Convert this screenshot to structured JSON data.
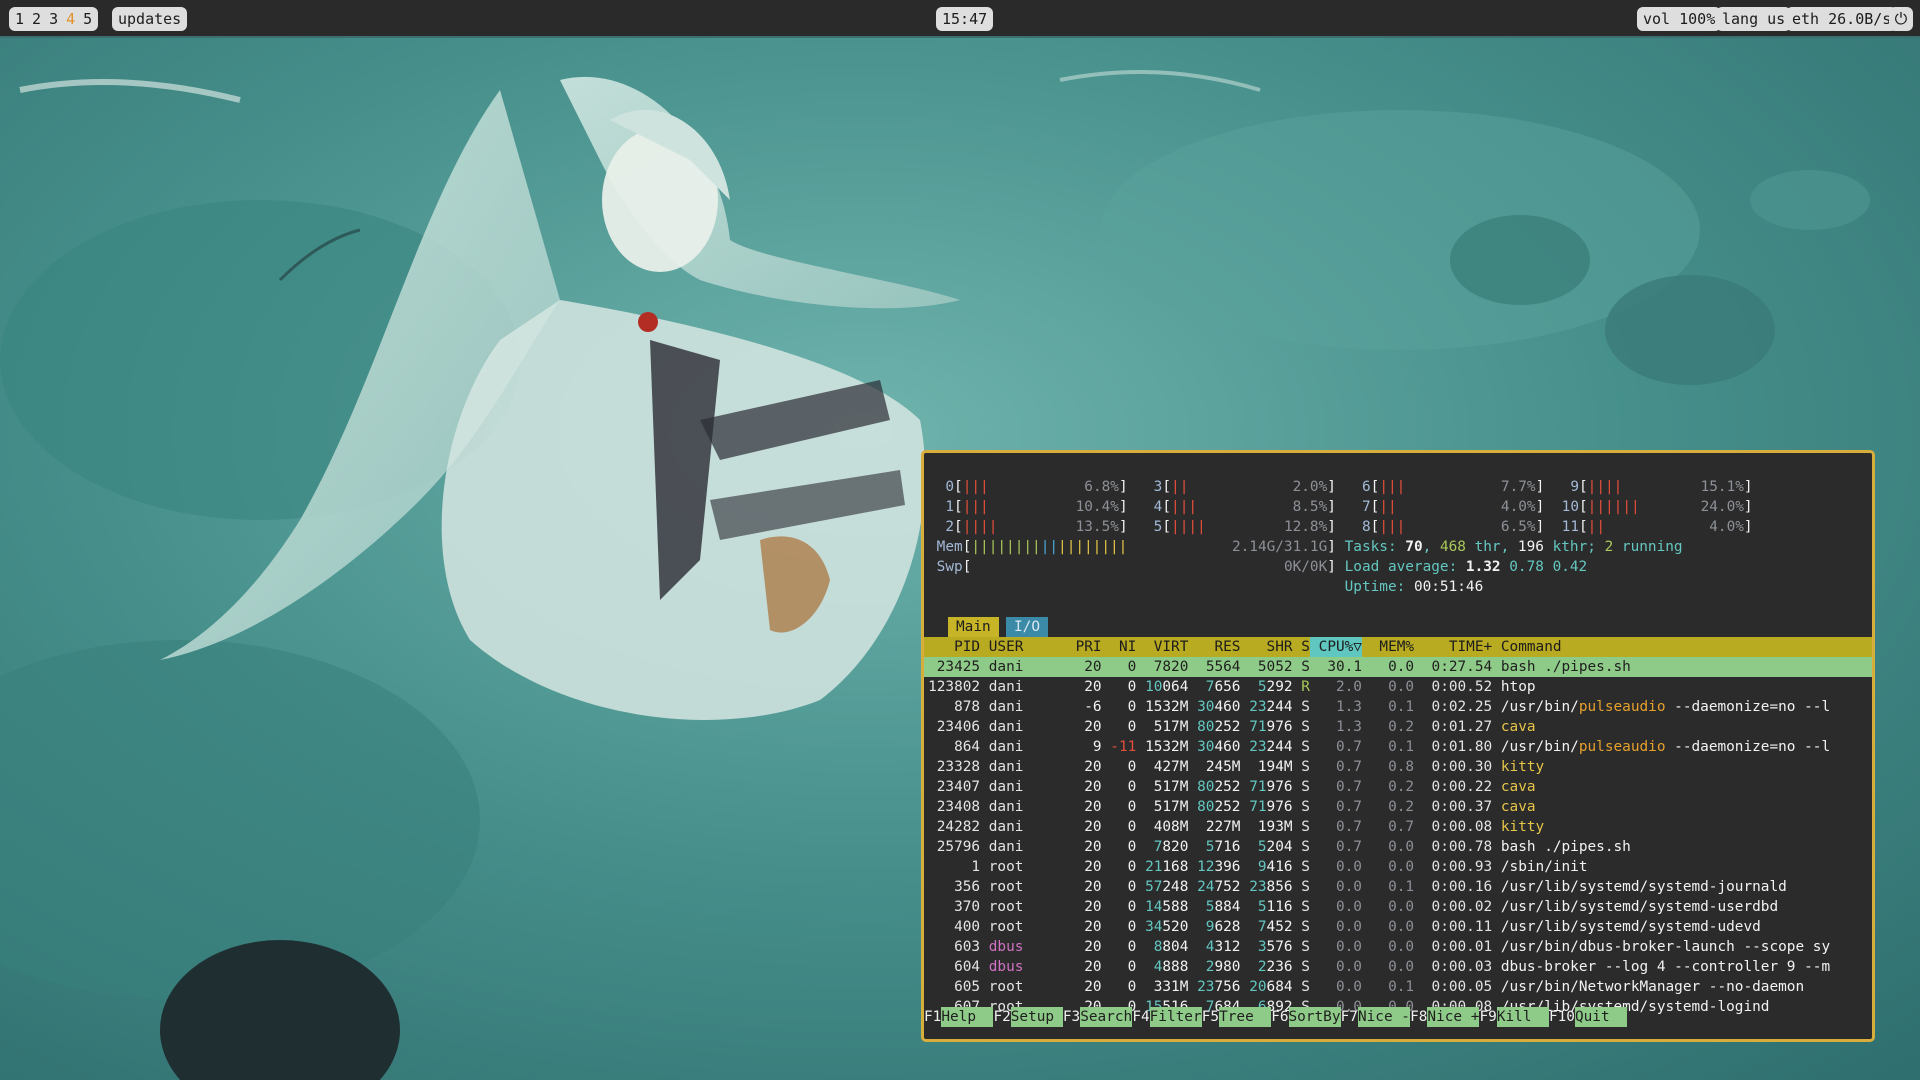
{
  "topbar": {
    "workspaces": [
      "1",
      "2",
      "3",
      "4",
      "5"
    ],
    "active_workspace": "4",
    "updates_label": "updates",
    "clock": "15:47",
    "volume": "vol 100%",
    "lang": "lang us",
    "network": "eth 26.0B/s",
    "power_icon": "power-icon"
  },
  "htop": {
    "cpus": [
      {
        "id": "0",
        "bars": "|||",
        "pct": "6.8%"
      },
      {
        "id": "1",
        "bars": "|||",
        "pct": "10.4%"
      },
      {
        "id": "2",
        "bars": "||||",
        "pct": "13.5%"
      },
      {
        "id": "3",
        "bars": "||",
        "pct": "2.0%"
      },
      {
        "id": "4",
        "bars": "|||",
        "pct": "8.5%"
      },
      {
        "id": "5",
        "bars": "||||",
        "pct": "12.8%"
      },
      {
        "id": "6",
        "bars": "|||",
        "pct": "7.7%"
      },
      {
        "id": "7",
        "bars": "||",
        "pct": "4.0%"
      },
      {
        "id": "8",
        "bars": "|||",
        "pct": "6.5%"
      },
      {
        "id": "9",
        "bars": "||||",
        "pct": "15.1%"
      },
      {
        "id": "10",
        "bars": "||||||",
        "pct": "24.0%"
      },
      {
        "id": "11",
        "bars": "||",
        "pct": "4.0%"
      }
    ],
    "mem_label": "Mem",
    "mem_bars": "||||||||||||||||||",
    "mem_value": "2.14G/31.1G",
    "swp_label": "Swp",
    "swp_value": "0K/0K",
    "tasks": {
      "label": "Tasks: ",
      "tasks": "70",
      "thr": "468",
      "thr_label": " thr, ",
      "kthr": "196",
      "kthr_label": " kthr; ",
      "running": "2",
      "running_label": " running"
    },
    "load": {
      "label": "Load average: ",
      "one": "1.32",
      "five": "0.78",
      "fifteen": "0.42"
    },
    "uptime": {
      "label": "Uptime: ",
      "value": "00:51:46"
    },
    "tabs": [
      "Main",
      "I/O"
    ],
    "columns": [
      "PID",
      "USER",
      "PRI",
      "NI",
      "VIRT",
      "RES",
      "SHR",
      "S",
      "CPU%▽",
      "MEM%",
      "TIME+",
      "Command"
    ],
    "processes": [
      {
        "pid": "23425",
        "user": "dani",
        "pri": "20",
        "ni": "0",
        "virt": "7820",
        "res": "5564",
        "shr": "5052",
        "s": "S",
        "cpu": "30.1",
        "mem": "0.0",
        "time": "0:27.54",
        "cmd": "bash ./pipes.sh",
        "selected": true
      },
      {
        "pid": "123802",
        "user": "dani",
        "pri": "20",
        "ni": "0",
        "virt": "10064",
        "res": "7656",
        "shr": "5292",
        "s": "R",
        "cpu": "2.0",
        "mem": "0.0",
        "time": "0:00.52",
        "cmd": "htop"
      },
      {
        "pid": "878",
        "user": "dani",
        "pri": "-6",
        "ni": "0",
        "virt": "1532M",
        "res": "30460",
        "shr": "23244",
        "s": "S",
        "cpu": "1.3",
        "mem": "0.1",
        "time": "0:02.25",
        "cmd": "/usr/bin/pulseaudio --daemonize=no --l"
      },
      {
        "pid": "23406",
        "user": "dani",
        "pri": "20",
        "ni": "0",
        "virt": "517M",
        "res": "80252",
        "shr": "71976",
        "s": "S",
        "cpu": "1.3",
        "mem": "0.2",
        "time": "0:01.27",
        "cmd": "cava"
      },
      {
        "pid": "864",
        "user": "dani",
        "pri": "9",
        "ni": "-11",
        "virt": "1532M",
        "res": "30460",
        "shr": "23244",
        "s": "S",
        "cpu": "0.7",
        "mem": "0.1",
        "time": "0:01.80",
        "cmd": "/usr/bin/pulseaudio --daemonize=no --l"
      },
      {
        "pid": "23328",
        "user": "dani",
        "pri": "20",
        "ni": "0",
        "virt": "427M",
        "res": "245M",
        "shr": "194M",
        "s": "S",
        "cpu": "0.7",
        "mem": "0.8",
        "time": "0:00.30",
        "cmd": "kitty"
      },
      {
        "pid": "23407",
        "user": "dani",
        "pri": "20",
        "ni": "0",
        "virt": "517M",
        "res": "80252",
        "shr": "71976",
        "s": "S",
        "cpu": "0.7",
        "mem": "0.2",
        "time": "0:00.22",
        "cmd": "cava"
      },
      {
        "pid": "23408",
        "user": "dani",
        "pri": "20",
        "ni": "0",
        "virt": "517M",
        "res": "80252",
        "shr": "71976",
        "s": "S",
        "cpu": "0.7",
        "mem": "0.2",
        "time": "0:00.37",
        "cmd": "cava"
      },
      {
        "pid": "24282",
        "user": "dani",
        "pri": "20",
        "ni": "0",
        "virt": "408M",
        "res": "227M",
        "shr": "193M",
        "s": "S",
        "cpu": "0.7",
        "mem": "0.7",
        "time": "0:00.08",
        "cmd": "kitty"
      },
      {
        "pid": "25796",
        "user": "dani",
        "pri": "20",
        "ni": "0",
        "virt": "7820",
        "res": "5716",
        "shr": "5204",
        "s": "S",
        "cpu": "0.7",
        "mem": "0.0",
        "time": "0:00.78",
        "cmd": "bash ./pipes.sh"
      },
      {
        "pid": "1",
        "user": "root",
        "pri": "20",
        "ni": "0",
        "virt": "21168",
        "res": "12396",
        "shr": "9416",
        "s": "S",
        "cpu": "0.0",
        "mem": "0.0",
        "time": "0:00.93",
        "cmd": "/sbin/init"
      },
      {
        "pid": "356",
        "user": "root",
        "pri": "20",
        "ni": "0",
        "virt": "57248",
        "res": "24752",
        "shr": "23856",
        "s": "S",
        "cpu": "0.0",
        "mem": "0.1",
        "time": "0:00.16",
        "cmd": "/usr/lib/systemd/systemd-journald"
      },
      {
        "pid": "370",
        "user": "root",
        "pri": "20",
        "ni": "0",
        "virt": "14588",
        "res": "5884",
        "shr": "5116",
        "s": "S",
        "cpu": "0.0",
        "mem": "0.0",
        "time": "0:00.02",
        "cmd": "/usr/lib/systemd/systemd-userdbd"
      },
      {
        "pid": "400",
        "user": "root",
        "pri": "20",
        "ni": "0",
        "virt": "34520",
        "res": "9628",
        "shr": "7452",
        "s": "S",
        "cpu": "0.0",
        "mem": "0.0",
        "time": "0:00.11",
        "cmd": "/usr/lib/systemd/systemd-udevd"
      },
      {
        "pid": "603",
        "user": "dbus",
        "pri": "20",
        "ni": "0",
        "virt": "8804",
        "res": "4312",
        "shr": "3576",
        "s": "S",
        "cpu": "0.0",
        "mem": "0.0",
        "time": "0:00.01",
        "cmd": "/usr/bin/dbus-broker-launch --scope sy"
      },
      {
        "pid": "604",
        "user": "dbus",
        "pri": "20",
        "ni": "0",
        "virt": "4888",
        "res": "2980",
        "shr": "2236",
        "s": "S",
        "cpu": "0.0",
        "mem": "0.0",
        "time": "0:00.03",
        "cmd": "dbus-broker --log 4 --controller 9 --m"
      },
      {
        "pid": "605",
        "user": "root",
        "pri": "20",
        "ni": "0",
        "virt": "331M",
        "res": "23756",
        "shr": "20684",
        "s": "S",
        "cpu": "0.0",
        "mem": "0.1",
        "time": "0:00.05",
        "cmd": "/usr/bin/NetworkManager --no-daemon"
      },
      {
        "pid": "607",
        "user": "root",
        "pri": "20",
        "ni": "0",
        "virt": "15516",
        "res": "7684",
        "shr": "6892",
        "s": "S",
        "cpu": "0.0",
        "mem": "0.0",
        "time": "0:00.08",
        "cmd": "/usr/lib/systemd/systemd-logind"
      }
    ],
    "fkeys": [
      {
        "key": "F1",
        "label": "Help  "
      },
      {
        "key": "F2",
        "label": "Setup "
      },
      {
        "key": "F3",
        "label": "Search"
      },
      {
        "key": "F4",
        "label": "Filter"
      },
      {
        "key": "F5",
        "label": "Tree  "
      },
      {
        "key": "F6",
        "label": "SortBy"
      },
      {
        "key": "F7",
        "label": "Nice -"
      },
      {
        "key": "F8",
        "label": "Nice +"
      },
      {
        "key": "F9",
        "label": "Kill  "
      },
      {
        "key": "F10",
        "label": "Quit  "
      }
    ]
  },
  "colors": {
    "accent_border": "#d7ad3c",
    "header_bg": "#b8aa21",
    "selected_row": "#8fcb88",
    "wallpaper_teal": "#3f8a86"
  }
}
